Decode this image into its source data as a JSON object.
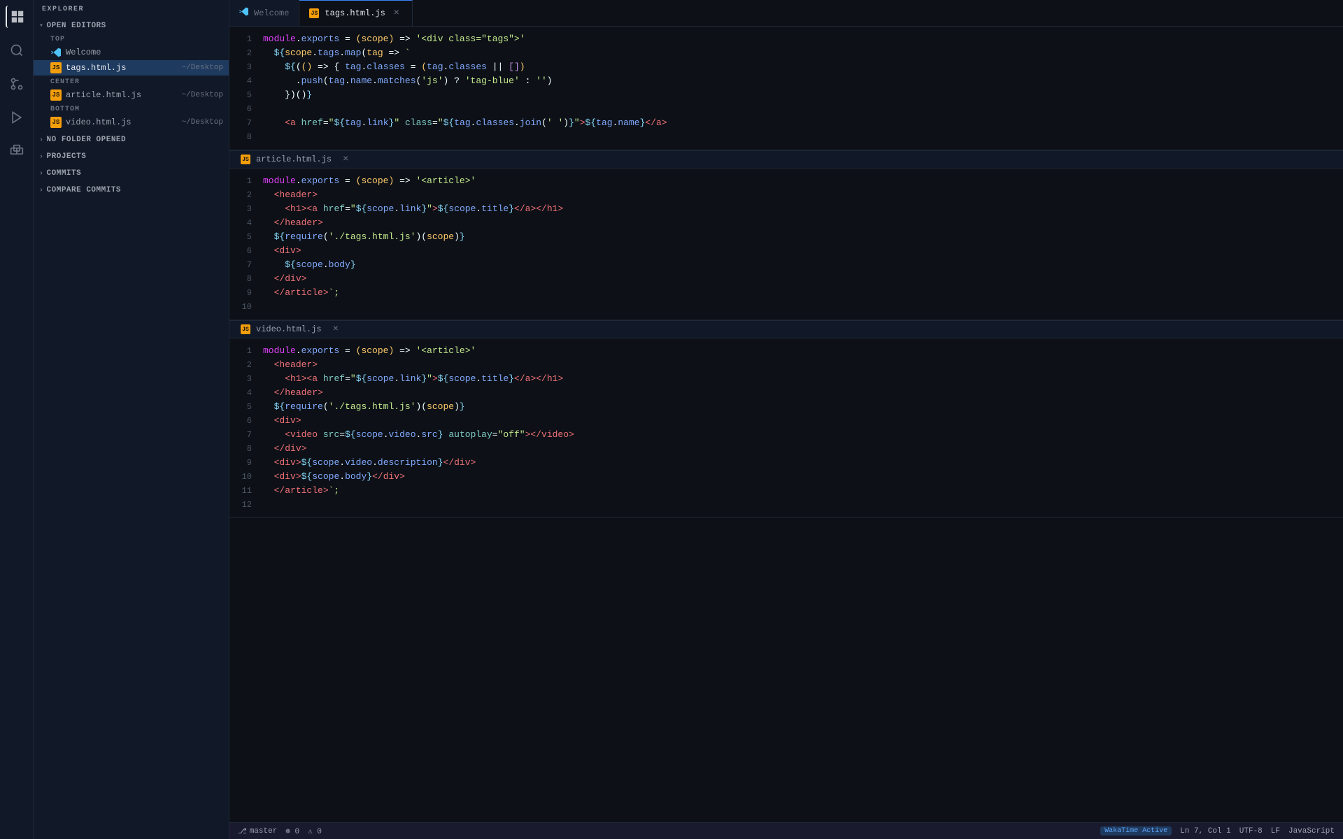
{
  "app": {
    "title": "Visual Studio Code"
  },
  "activity_bar": {
    "icons": [
      {
        "name": "explorer-icon",
        "symbol": "⊞",
        "active": true
      },
      {
        "name": "search-icon",
        "symbol": "🔍",
        "active": false
      },
      {
        "name": "git-icon",
        "symbol": "⎇",
        "active": false
      },
      {
        "name": "debug-icon",
        "symbol": "▶",
        "active": false
      },
      {
        "name": "extensions-icon",
        "symbol": "⊟",
        "active": false
      }
    ]
  },
  "sidebar": {
    "title": "EXPLORER",
    "sections": [
      {
        "label": "OPEN EDITORS",
        "expanded": true,
        "subsections": [
          {
            "label": "TOP",
            "items": [
              {
                "icon": "vscode",
                "label": "Welcome",
                "path": "",
                "active": false
              }
            ]
          },
          {
            "label": "",
            "items": [
              {
                "icon": "js",
                "label": "tags.html.js",
                "path": "~/Desktop",
                "active": true
              }
            ]
          },
          {
            "label": "CENTER",
            "items": [
              {
                "icon": "js",
                "label": "article.html.js",
                "path": "~/Desktop",
                "active": false
              }
            ]
          },
          {
            "label": "BOTTOM",
            "items": [
              {
                "icon": "js",
                "label": "video.html.js",
                "path": "~/Desktop",
                "active": false
              }
            ]
          }
        ]
      },
      {
        "label": "NO FOLDER OPENED",
        "expanded": false,
        "items": []
      },
      {
        "label": "PROJECTS",
        "expanded": false,
        "items": []
      },
      {
        "label": "COMMITS",
        "expanded": false,
        "items": []
      },
      {
        "label": "COMPARE COMMITS",
        "expanded": false,
        "items": []
      }
    ]
  },
  "tabs": [
    {
      "label": "Welcome",
      "icon": "vscode",
      "active": false,
      "closeable": false
    },
    {
      "label": "tags.html.js",
      "icon": "js",
      "active": true,
      "closeable": true
    }
  ],
  "code_blocks": [
    {
      "filename": "tags.html.js",
      "icon": "js",
      "lines": [
        {
          "num": 1,
          "code": "module.exports = (scope) => '<div class=\"tags\">'"
        },
        {
          "num": 2,
          "code": "  ${scope.tags.map(tag => `"
        },
        {
          "num": 3,
          "code": "    ${(() => { tag.classes = (tag.classes || [])"
        },
        {
          "num": 4,
          "code": "      .push(tag.name.matches('js') ? 'tag-blue' : '')"
        },
        {
          "num": 5,
          "code": "    })()"
        },
        {
          "num": 6,
          "code": ""
        },
        {
          "num": 7,
          "code": "    <a href=\"${tag.link}\" class=\"${tag.classes.join(' ')}\">${tag.name}</a>"
        },
        {
          "num": 8,
          "code": ""
        }
      ]
    },
    {
      "filename": "article.html.js",
      "icon": "js",
      "lines": [
        {
          "num": 1,
          "code": "module.exports = (scope) => '<article>'"
        },
        {
          "num": 2,
          "code": "  <header>"
        },
        {
          "num": 3,
          "code": "    <h1><a href=\"${scope.link}\">${scope.title}</a></h1>"
        },
        {
          "num": 4,
          "code": "  </header>"
        },
        {
          "num": 5,
          "code": "  ${require('./tags.html.js')(scope)}"
        },
        {
          "num": 6,
          "code": "  <div>"
        },
        {
          "num": 7,
          "code": "    ${scope.body}"
        },
        {
          "num": 8,
          "code": "  </div>"
        },
        {
          "num": 9,
          "code": "  </article>`;"
        },
        {
          "num": 10,
          "code": ""
        }
      ]
    },
    {
      "filename": "video.html.js",
      "icon": "js",
      "lines": [
        {
          "num": 1,
          "code": "module.exports = (scope) => '<article>'"
        },
        {
          "num": 2,
          "code": "  <header>"
        },
        {
          "num": 3,
          "code": "    <h1><a href=\"${scope.link}\">${scope.title}</a></h1>"
        },
        {
          "num": 4,
          "code": "  </header>"
        },
        {
          "num": 5,
          "code": "  ${require('./tags.html.js')(scope)}"
        },
        {
          "num": 6,
          "code": "  <div>"
        },
        {
          "num": 7,
          "code": "    <video src=${scope.video.src} autoplay=\"off\"></video>"
        },
        {
          "num": 8,
          "code": "  </div>"
        },
        {
          "num": 9,
          "code": "  <div>${scope.video.description}</div>"
        },
        {
          "num": 10,
          "code": "  <div>${scope.body}</div>"
        },
        {
          "num": 11,
          "code": "  </article>`;"
        },
        {
          "num": 12,
          "code": ""
        }
      ]
    }
  ],
  "status_bar": {
    "branch_icon": "⎇",
    "branch": "master",
    "errors": "⊗ 0",
    "warnings": "⚠ 0",
    "wakatime": "WakaTime Active",
    "encoding": "UTF-8",
    "line_ending": "LF",
    "language": "JavaScript",
    "position": "Ln 7, Col 1"
  }
}
